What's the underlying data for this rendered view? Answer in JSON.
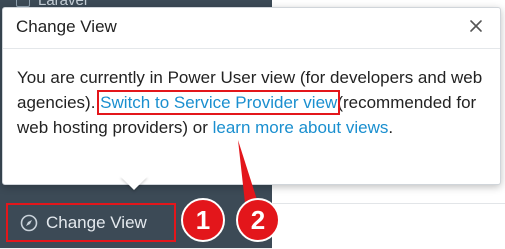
{
  "sidebar": {
    "top_item_label": "Laravel",
    "change_view_label": "Change View"
  },
  "popover": {
    "title": "Change View",
    "body_prefix": "You are currently in Power User view (for developers and web agencies).",
    "link_service_provider": "Switch to Service Provider view",
    "body_middle": "(recommended for web hosting providers) or ",
    "link_learn_more": "learn more about views",
    "body_suffix": "."
  },
  "annotations": {
    "badge_1": "1",
    "badge_2": "2"
  },
  "colors": {
    "sidebar_bg": "#3c4a56",
    "annotation_red": "#e3161b",
    "link_blue": "#1a8fcf"
  }
}
